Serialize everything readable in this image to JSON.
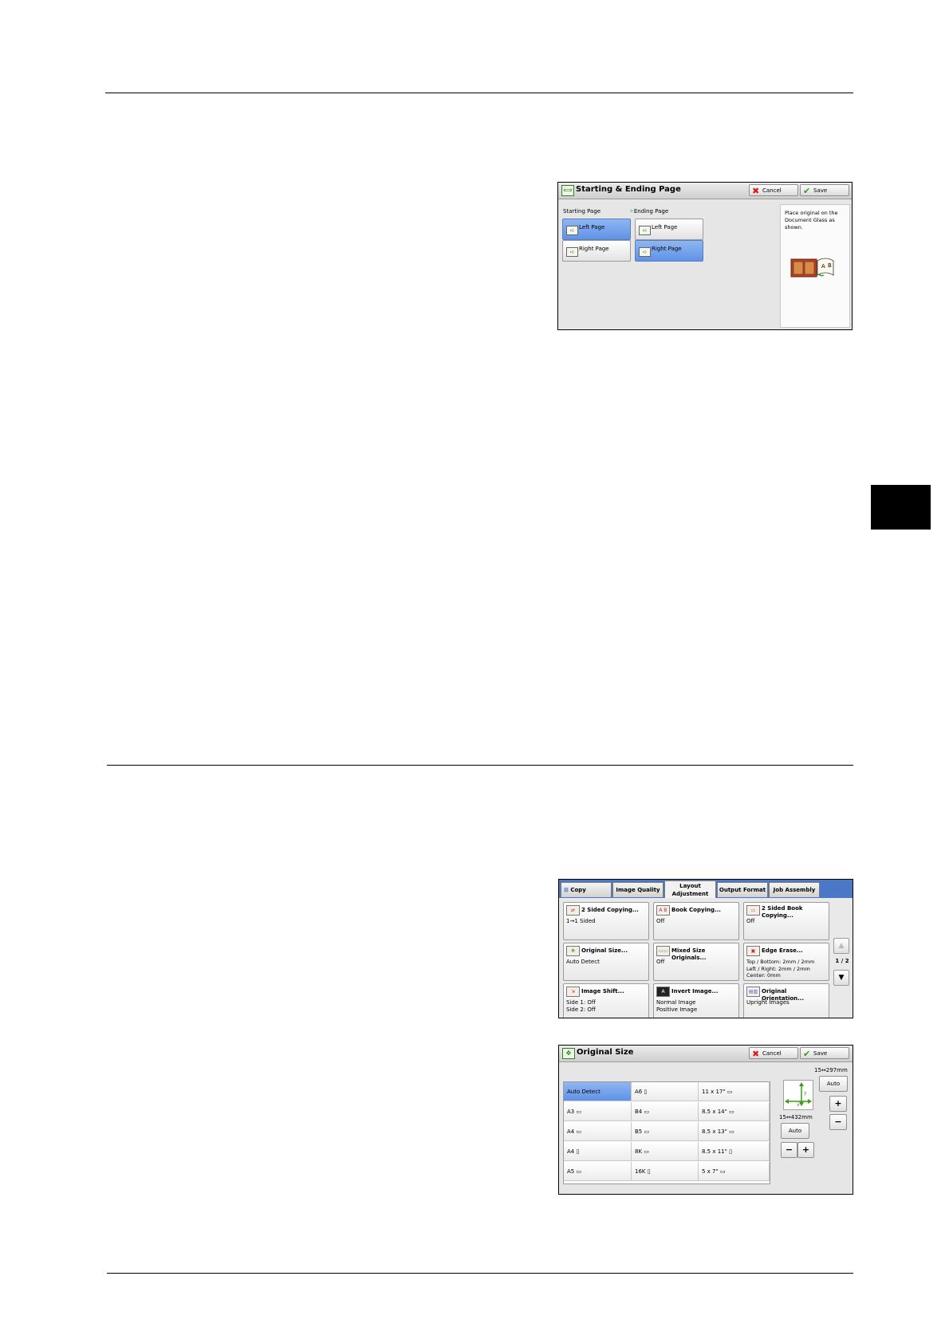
{
  "colors": {
    "accent": "#4a78c6",
    "selected": "#6f9fec",
    "cancel": "#d61b1b",
    "save": "#3a9a1a"
  },
  "panel1": {
    "title": "Starting & Ending Page",
    "cancel_label": "Cancel",
    "save_label": "Save",
    "starting_label": "Starting Page",
    "ending_label": "Ending Page",
    "start_left": "Left Page",
    "start_right": "Right Page",
    "end_left": "Left Page",
    "end_right": "Right Page",
    "selected_start": "Left Page",
    "selected_end": "Right Page",
    "info_text": "Place original on the Document Glass as shown.",
    "book_left_letter": "A",
    "book_right_letter": "B"
  },
  "panel2": {
    "tabs": [
      "Copy",
      "Image Quality",
      "Layout Adjustment",
      "Output Format",
      "Job Assembly"
    ],
    "features": [
      {
        "title": "2 Sided Copying...",
        "value": "1→1 Sided",
        "icon": "two-sided-icon"
      },
      {
        "title": "Book Copying...",
        "value": "Off",
        "icon": "book-icon"
      },
      {
        "title": "2 Sided Book Copying...",
        "value": "Off",
        "icon": "two-sided-book-icon"
      },
      {
        "title": "Original Size...",
        "value": "Auto Detect",
        "icon": "original-size-icon"
      },
      {
        "title": "Mixed Size Originals...",
        "value": "Off",
        "icon": "mixed-size-icon"
      },
      {
        "title": "Edge Erase...",
        "value": "Top / Bottom: 2mm / 2mm\nLeft / Right: 2mm / 2mm\nCenter: 0mm",
        "icon": "edge-erase-icon"
      },
      {
        "title": "Image Shift...",
        "value": "Side 1: Off\nSide 2: Off",
        "icon": "image-shift-icon"
      },
      {
        "title": "Invert Image...",
        "value": "Normal Image\nPositive Image",
        "icon": "invert-image-icon"
      },
      {
        "title": "Original Orientation...",
        "value": "Upright Images",
        "icon": "orientation-icon"
      }
    ],
    "page_indicator": "1 / 2"
  },
  "panel3": {
    "title": "Original Size",
    "cancel_label": "Cancel",
    "save_label": "Save",
    "sizes": [
      [
        "Auto Detect",
        "A6 ▯",
        "11 x 17\" ▭"
      ],
      [
        "A3 ▭",
        "B4 ▭",
        "8.5 x 14\" ▭"
      ],
      [
        "A4 ▭",
        "B5 ▭",
        "8.5 x 13\" ▭"
      ],
      [
        "A4 ▯",
        "8K ▭",
        "8.5 x 11\" ▯"
      ],
      [
        "A5 ▭",
        "16K ▯",
        "5 x 7\" ▭"
      ]
    ],
    "y_range": "15↔297mm",
    "x_range": "15↔432mm",
    "auto_label": "Auto",
    "y_axis_letter": "y",
    "x_axis_letter": "x"
  }
}
